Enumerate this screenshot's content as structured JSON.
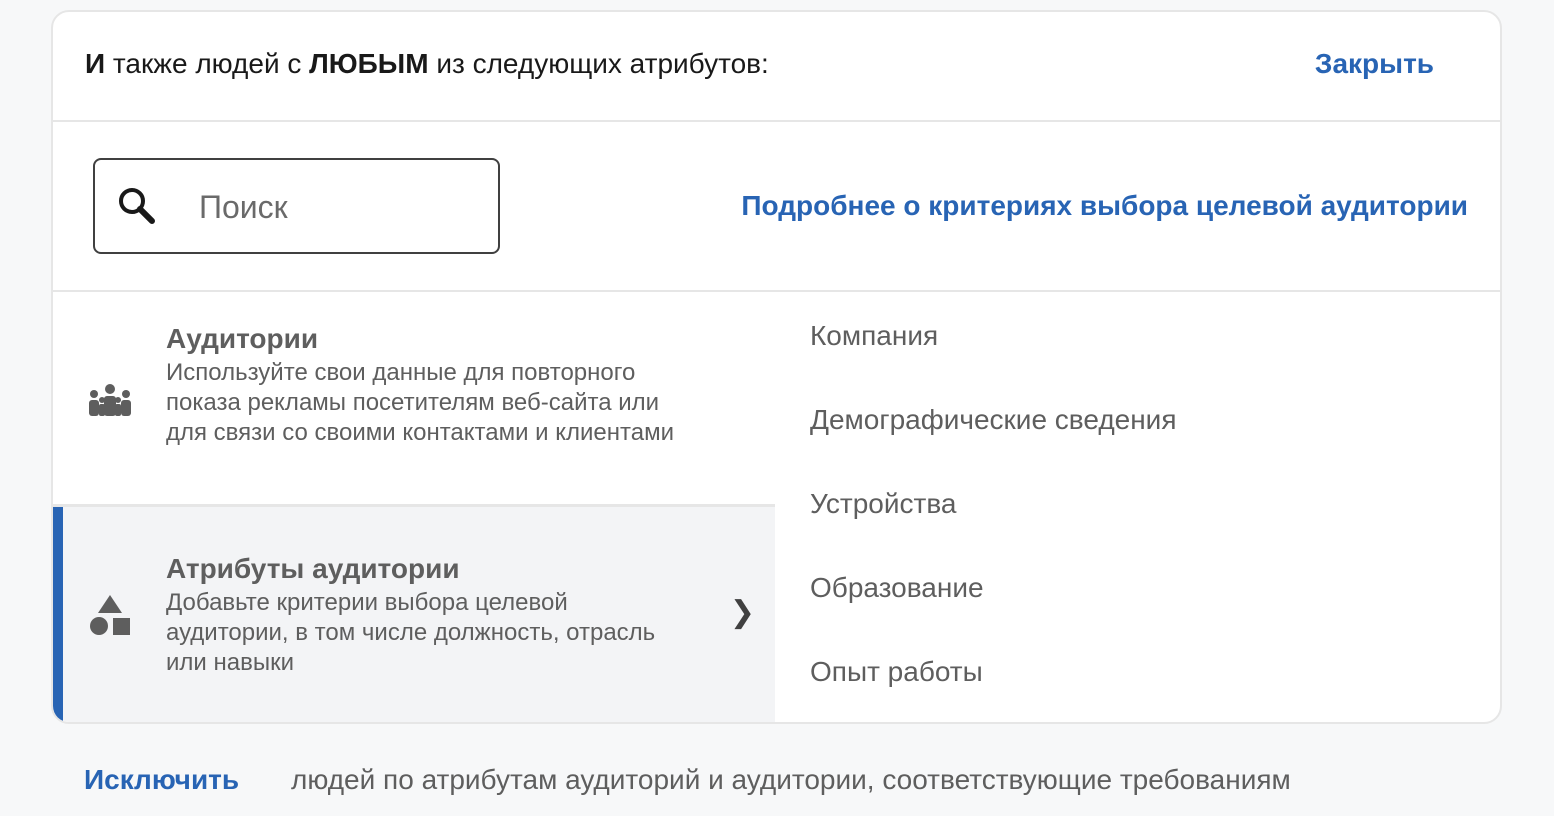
{
  "header": {
    "prefix_bold": "И",
    "text_1": " также людей с ",
    "any_bold": "ЛЮБЫМ",
    "text_2": " из следующих атрибутов:",
    "close_label": "Закрыть"
  },
  "search": {
    "placeholder": "Поиск",
    "value": ""
  },
  "learn_more_link": "Подробнее о критериях выбора целевой аудитории",
  "categories": [
    {
      "title": "Аудитории",
      "description": "Используйте свои данные для повторного показа рекламы посетителям веб-сайта или для связи со своими контактами и клиентами",
      "icon": "people-group-icon",
      "selected": false
    },
    {
      "title": "Атрибуты аудитории",
      "description": "Добавьте критерии выбора целевой аудитории, в том числе должность, отрасль или навыки",
      "icon": "shapes-icon",
      "selected": true,
      "chevron": "❯"
    }
  ],
  "subcategories": [
    "Компания",
    "Демографические сведения",
    "Устройства",
    "Образование",
    "Опыт работы"
  ],
  "footer": {
    "exclude_label": "Исключить",
    "text": "людей по атрибутам аудиторий и аудитории, соответствующие требованиям"
  },
  "colors": {
    "accent": "#2864b4",
    "border": "#e6e6e6",
    "selected_bg": "#f3f4f6",
    "text_secondary": "#5e5e5e"
  }
}
